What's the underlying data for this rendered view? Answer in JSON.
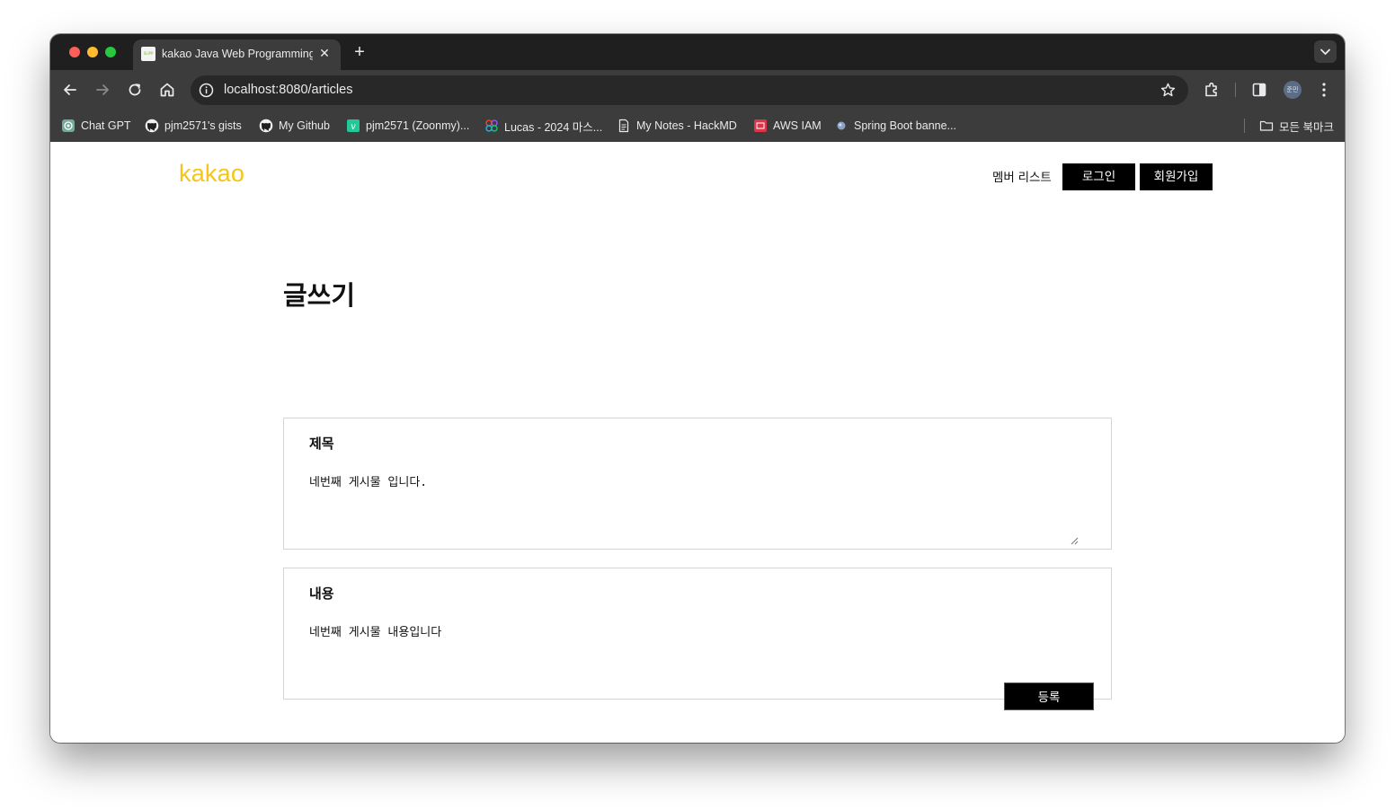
{
  "browser": {
    "tab": {
      "title": "kakao Java Web Programming",
      "favicon_text": "SLIPP"
    },
    "url": "localhost:8080/articles",
    "profile_label": "준민",
    "bookmarks": [
      {
        "label": "Chat GPT",
        "icon": "chatgpt-icon"
      },
      {
        "label": "pjm2571's gists",
        "icon": "github-icon"
      },
      {
        "label": "My Github",
        "icon": "github-icon"
      },
      {
        "label": "pjm2571 (Zoonmy)...",
        "icon": "velog-icon"
      },
      {
        "label": "Lucas - 2024 마스...",
        "icon": "figma-icon"
      },
      {
        "label": "My Notes - HackMD",
        "icon": "document-icon"
      },
      {
        "label": "AWS IAM",
        "icon": "aws-icon"
      },
      {
        "label": "Spring Boot banne...",
        "icon": "globe-icon"
      }
    ],
    "all_bookmarks_label": "모든 북마크"
  },
  "header": {
    "logo": "kakao",
    "member_list": "멤버 리스트",
    "login": "로그인",
    "signup": "회원가입"
  },
  "main": {
    "title": "글쓰기",
    "title_field": {
      "label": "제목",
      "value": "네번째 게시물 입니다."
    },
    "content_field": {
      "label": "내용",
      "value": "네번째 게시물 내용입니다"
    },
    "submit": "등록"
  },
  "colors": {
    "logo": "#f5c518",
    "button": "#000000",
    "chrome_dark": "#3c3c3c"
  }
}
